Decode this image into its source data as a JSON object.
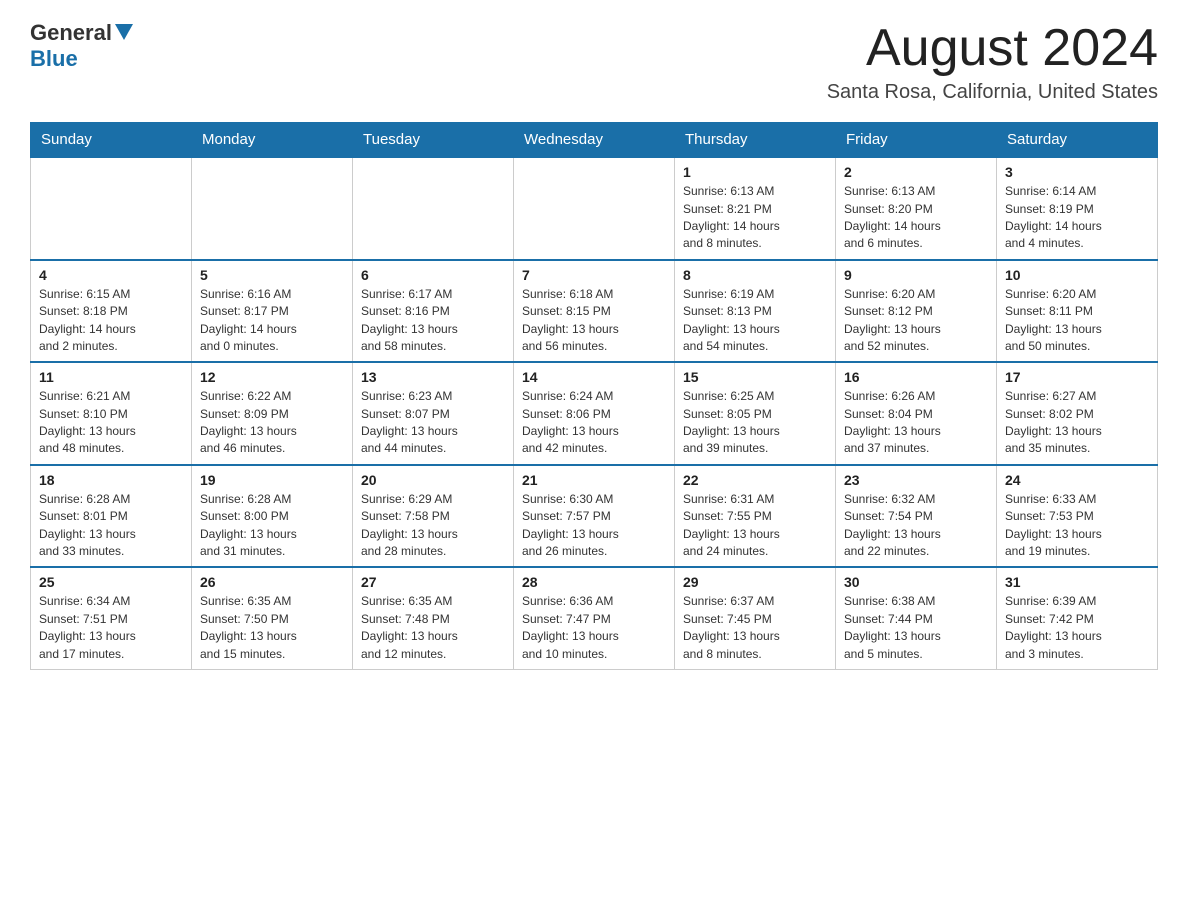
{
  "header": {
    "logo_general": "General",
    "logo_blue": "Blue",
    "title": "August 2024",
    "location": "Santa Rosa, California, United States"
  },
  "weekdays": [
    "Sunday",
    "Monday",
    "Tuesday",
    "Wednesday",
    "Thursday",
    "Friday",
    "Saturday"
  ],
  "weeks": [
    [
      {
        "day": "",
        "info": ""
      },
      {
        "day": "",
        "info": ""
      },
      {
        "day": "",
        "info": ""
      },
      {
        "day": "",
        "info": ""
      },
      {
        "day": "1",
        "info": "Sunrise: 6:13 AM\nSunset: 8:21 PM\nDaylight: 14 hours\nand 8 minutes."
      },
      {
        "day": "2",
        "info": "Sunrise: 6:13 AM\nSunset: 8:20 PM\nDaylight: 14 hours\nand 6 minutes."
      },
      {
        "day": "3",
        "info": "Sunrise: 6:14 AM\nSunset: 8:19 PM\nDaylight: 14 hours\nand 4 minutes."
      }
    ],
    [
      {
        "day": "4",
        "info": "Sunrise: 6:15 AM\nSunset: 8:18 PM\nDaylight: 14 hours\nand 2 minutes."
      },
      {
        "day": "5",
        "info": "Sunrise: 6:16 AM\nSunset: 8:17 PM\nDaylight: 14 hours\nand 0 minutes."
      },
      {
        "day": "6",
        "info": "Sunrise: 6:17 AM\nSunset: 8:16 PM\nDaylight: 13 hours\nand 58 minutes."
      },
      {
        "day": "7",
        "info": "Sunrise: 6:18 AM\nSunset: 8:15 PM\nDaylight: 13 hours\nand 56 minutes."
      },
      {
        "day": "8",
        "info": "Sunrise: 6:19 AM\nSunset: 8:13 PM\nDaylight: 13 hours\nand 54 minutes."
      },
      {
        "day": "9",
        "info": "Sunrise: 6:20 AM\nSunset: 8:12 PM\nDaylight: 13 hours\nand 52 minutes."
      },
      {
        "day": "10",
        "info": "Sunrise: 6:20 AM\nSunset: 8:11 PM\nDaylight: 13 hours\nand 50 minutes."
      }
    ],
    [
      {
        "day": "11",
        "info": "Sunrise: 6:21 AM\nSunset: 8:10 PM\nDaylight: 13 hours\nand 48 minutes."
      },
      {
        "day": "12",
        "info": "Sunrise: 6:22 AM\nSunset: 8:09 PM\nDaylight: 13 hours\nand 46 minutes."
      },
      {
        "day": "13",
        "info": "Sunrise: 6:23 AM\nSunset: 8:07 PM\nDaylight: 13 hours\nand 44 minutes."
      },
      {
        "day": "14",
        "info": "Sunrise: 6:24 AM\nSunset: 8:06 PM\nDaylight: 13 hours\nand 42 minutes."
      },
      {
        "day": "15",
        "info": "Sunrise: 6:25 AM\nSunset: 8:05 PM\nDaylight: 13 hours\nand 39 minutes."
      },
      {
        "day": "16",
        "info": "Sunrise: 6:26 AM\nSunset: 8:04 PM\nDaylight: 13 hours\nand 37 minutes."
      },
      {
        "day": "17",
        "info": "Sunrise: 6:27 AM\nSunset: 8:02 PM\nDaylight: 13 hours\nand 35 minutes."
      }
    ],
    [
      {
        "day": "18",
        "info": "Sunrise: 6:28 AM\nSunset: 8:01 PM\nDaylight: 13 hours\nand 33 minutes."
      },
      {
        "day": "19",
        "info": "Sunrise: 6:28 AM\nSunset: 8:00 PM\nDaylight: 13 hours\nand 31 minutes."
      },
      {
        "day": "20",
        "info": "Sunrise: 6:29 AM\nSunset: 7:58 PM\nDaylight: 13 hours\nand 28 minutes."
      },
      {
        "day": "21",
        "info": "Sunrise: 6:30 AM\nSunset: 7:57 PM\nDaylight: 13 hours\nand 26 minutes."
      },
      {
        "day": "22",
        "info": "Sunrise: 6:31 AM\nSunset: 7:55 PM\nDaylight: 13 hours\nand 24 minutes."
      },
      {
        "day": "23",
        "info": "Sunrise: 6:32 AM\nSunset: 7:54 PM\nDaylight: 13 hours\nand 22 minutes."
      },
      {
        "day": "24",
        "info": "Sunrise: 6:33 AM\nSunset: 7:53 PM\nDaylight: 13 hours\nand 19 minutes."
      }
    ],
    [
      {
        "day": "25",
        "info": "Sunrise: 6:34 AM\nSunset: 7:51 PM\nDaylight: 13 hours\nand 17 minutes."
      },
      {
        "day": "26",
        "info": "Sunrise: 6:35 AM\nSunset: 7:50 PM\nDaylight: 13 hours\nand 15 minutes."
      },
      {
        "day": "27",
        "info": "Sunrise: 6:35 AM\nSunset: 7:48 PM\nDaylight: 13 hours\nand 12 minutes."
      },
      {
        "day": "28",
        "info": "Sunrise: 6:36 AM\nSunset: 7:47 PM\nDaylight: 13 hours\nand 10 minutes."
      },
      {
        "day": "29",
        "info": "Sunrise: 6:37 AM\nSunset: 7:45 PM\nDaylight: 13 hours\nand 8 minutes."
      },
      {
        "day": "30",
        "info": "Sunrise: 6:38 AM\nSunset: 7:44 PM\nDaylight: 13 hours\nand 5 minutes."
      },
      {
        "day": "31",
        "info": "Sunrise: 6:39 AM\nSunset: 7:42 PM\nDaylight: 13 hours\nand 3 minutes."
      }
    ]
  ]
}
